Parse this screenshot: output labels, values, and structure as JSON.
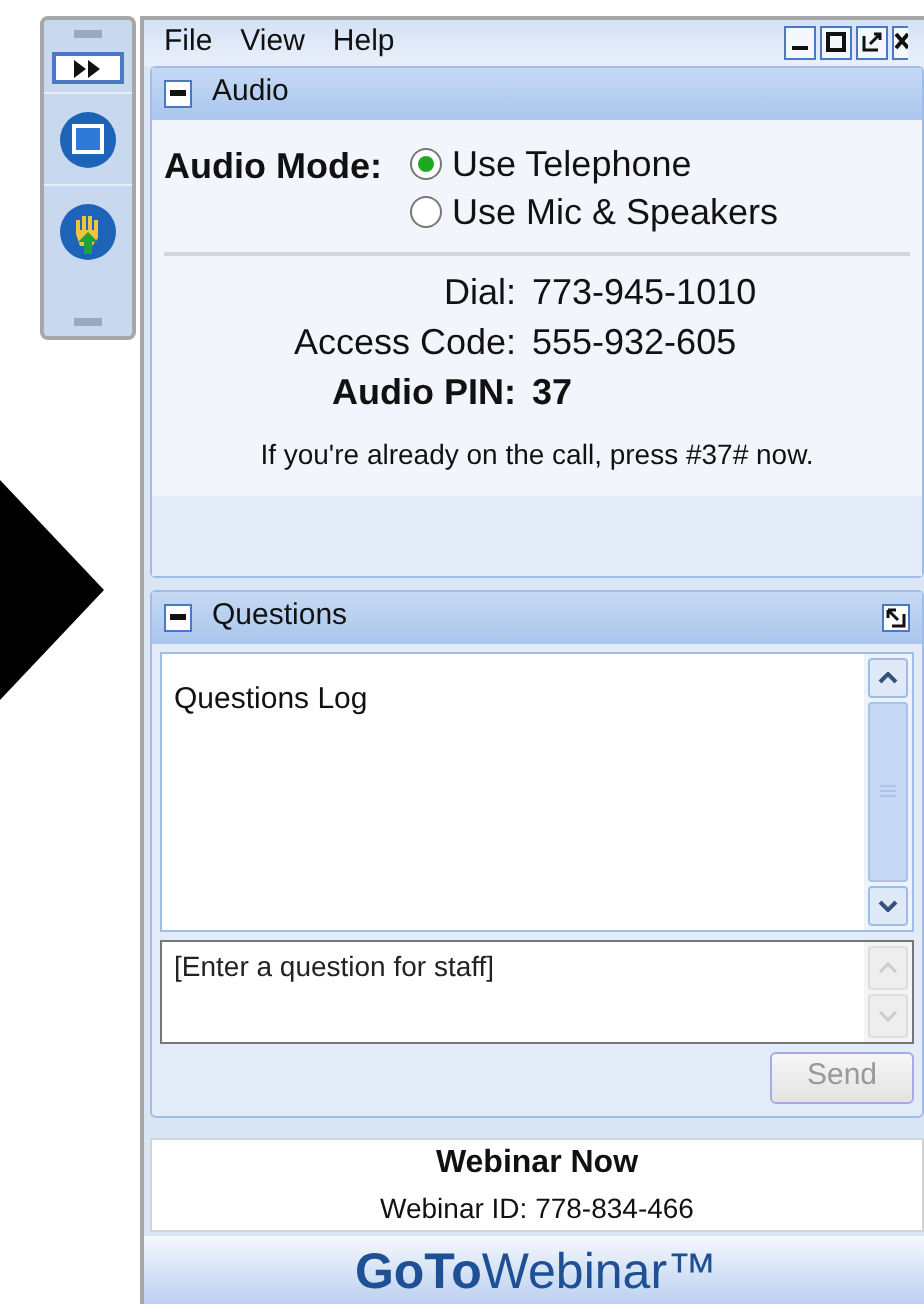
{
  "menu": [
    "File",
    "View",
    "Help"
  ],
  "audio": {
    "title": "Audio",
    "mode_label": "Audio Mode:",
    "options": [
      {
        "label": "Use Telephone",
        "selected": true
      },
      {
        "label": "Use Mic & Speakers",
        "selected": false
      }
    ],
    "details": [
      {
        "label": "Dial:",
        "value": "773-945-1010",
        "bold": false
      },
      {
        "label": "Access Code:",
        "value": "555-932-605",
        "bold": false
      },
      {
        "label": "Audio PIN:",
        "value": "37",
        "bold": true
      }
    ],
    "note": "If you're already on the call, press #37# now."
  },
  "questions": {
    "title": "Questions",
    "log": "Questions Log",
    "placeholder": "[Enter a question for staff]",
    "send": {
      "label": "Send",
      "disabled": true
    }
  },
  "footer": {
    "title": "Webinar Now",
    "id": "Webinar ID: 778-834-466",
    "logo": "**GoTo**Webinar™"
  }
}
